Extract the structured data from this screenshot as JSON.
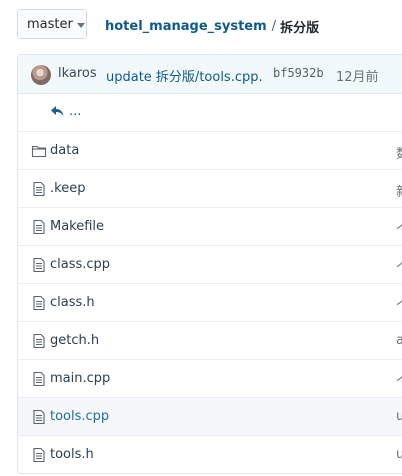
{
  "branch": {
    "label": "master"
  },
  "breadcrumb": {
    "repo": "hotel_manage_system",
    "separator": "/",
    "current": "拆分版"
  },
  "commit": {
    "author": "lkaros",
    "message": "update 拆分版/tools.cpp.",
    "sha": "bf5932b",
    "time": "12月前"
  },
  "up_link": {
    "label": "..."
  },
  "files": [
    {
      "name": "data",
      "type": "folder",
      "trail": "数"
    },
    {
      "name": ".keep",
      "type": "file",
      "trail": "新"
    },
    {
      "name": "Makefile",
      "type": "file",
      "trail": "个"
    },
    {
      "name": "class.cpp",
      "type": "file",
      "trail": "个"
    },
    {
      "name": "class.h",
      "type": "file",
      "trail": "个"
    },
    {
      "name": "getch.h",
      "type": "file",
      "trail": "a"
    },
    {
      "name": "main.cpp",
      "type": "file",
      "trail": "个"
    },
    {
      "name": "tools.cpp",
      "type": "file",
      "trail": "u"
    },
    {
      "name": "tools.h",
      "type": "file",
      "trail": "u"
    }
  ]
}
